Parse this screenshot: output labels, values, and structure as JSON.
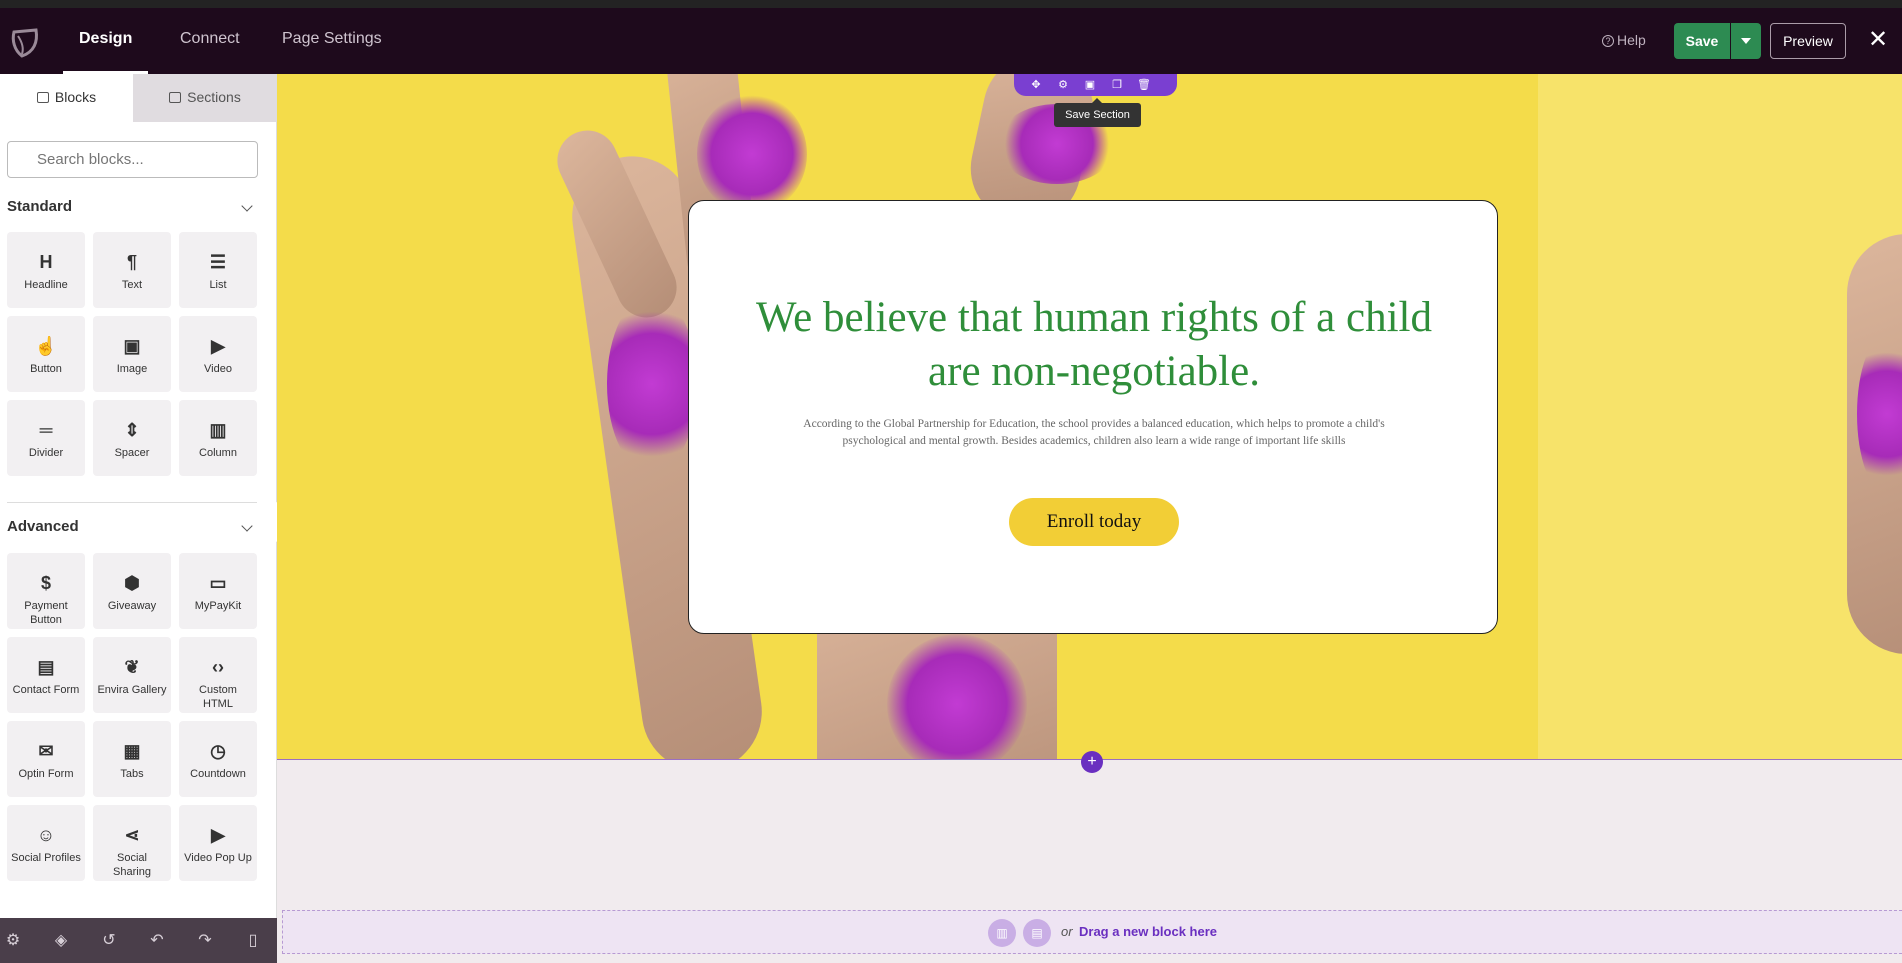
{
  "topbar": {
    "tabs": [
      {
        "label": "Design",
        "active": true
      },
      {
        "label": "Connect",
        "active": false
      },
      {
        "label": "Page Settings",
        "active": false
      }
    ],
    "help_label": "Help",
    "save_label": "Save",
    "preview_label": "Preview",
    "close_glyph": "✕"
  },
  "sidebar": {
    "tabs": [
      {
        "label": "Blocks",
        "icon": "blocks-icon"
      },
      {
        "label": "Sections",
        "icon": "sections-icon"
      }
    ],
    "search_placeholder": "Search blocks...",
    "standard": {
      "title": "Standard",
      "blocks": [
        {
          "label": "Headline",
          "icon": "headline-icon",
          "glyph": "H"
        },
        {
          "label": "Text",
          "icon": "paragraph-icon",
          "glyph": "¶"
        },
        {
          "label": "List",
          "icon": "list-icon",
          "glyph": "☰"
        },
        {
          "label": "Button",
          "icon": "pointer-icon",
          "glyph": "☝"
        },
        {
          "label": "Image",
          "icon": "image-icon",
          "glyph": "▣"
        },
        {
          "label": "Video",
          "icon": "video-icon",
          "glyph": "▶"
        },
        {
          "label": "Divider",
          "icon": "divider-icon",
          "glyph": "═"
        },
        {
          "label": "Spacer",
          "icon": "spacer-icon",
          "glyph": "⇕"
        },
        {
          "label": "Column",
          "icon": "column-icon",
          "glyph": "▥"
        }
      ]
    },
    "advanced": {
      "title": "Advanced",
      "blocks": [
        {
          "label": "Payment Button",
          "icon": "payment-icon",
          "glyph": "$"
        },
        {
          "label": "Giveaway",
          "icon": "giveaway-icon",
          "glyph": "⬢"
        },
        {
          "label": "MyPayKit",
          "icon": "card-icon",
          "glyph": "▭"
        },
        {
          "label": "Contact Form",
          "icon": "form-icon",
          "glyph": "▤"
        },
        {
          "label": "Envira Gallery",
          "icon": "leaf-icon",
          "glyph": "❦"
        },
        {
          "label": "Custom HTML",
          "icon": "code-icon",
          "glyph": "‹›"
        },
        {
          "label": "Optin Form",
          "icon": "mail-icon",
          "glyph": "✉"
        },
        {
          "label": "Tabs",
          "icon": "tabs-icon",
          "glyph": "▦"
        },
        {
          "label": "Countdown",
          "icon": "timer-icon",
          "glyph": "◷"
        },
        {
          "label": "Social Profiles",
          "icon": "users-icon",
          "glyph": "☺"
        },
        {
          "label": "Social Sharing",
          "icon": "share-icon",
          "glyph": "⋖"
        },
        {
          "label": "Video Pop Up",
          "icon": "video-popup-icon",
          "glyph": "▶"
        }
      ]
    },
    "bottom_tools": [
      {
        "icon": "settings-icon",
        "glyph": "⚙"
      },
      {
        "icon": "layers-icon",
        "glyph": "◈"
      },
      {
        "icon": "history-icon",
        "glyph": "↺"
      },
      {
        "icon": "undo-icon",
        "glyph": "↶"
      },
      {
        "icon": "redo-icon",
        "glyph": "↷"
      },
      {
        "icon": "device-icon",
        "glyph": "▯"
      }
    ]
  },
  "canvas": {
    "section_toolbar": [
      {
        "icon": "move-icon",
        "glyph": "✥"
      },
      {
        "icon": "section-settings-icon",
        "glyph": "⚙"
      },
      {
        "icon": "save-section-icon",
        "glyph": "▣"
      },
      {
        "icon": "duplicate-icon",
        "glyph": "❐"
      },
      {
        "icon": "delete-icon",
        "glyph": "🗑"
      }
    ],
    "tooltip": "Save Section",
    "headline": "We believe that human rights of a child are non-negotiable.",
    "subtext": "According to the Global Partnership for Education, the school provides a balanced education, which helps to promote a child's psychological and mental growth. Besides academics, children also learn a wide range of important life skills",
    "button_label": "Enroll today",
    "add_glyph": "+",
    "dropzone": {
      "or_text": "or",
      "cta": "Drag a new block here"
    }
  },
  "colors": {
    "topbar_bg": "#1e0a1c",
    "save_green": "#2d8b52",
    "hero_yellow": "#f4dc4a",
    "headline_green": "#2f8e3a",
    "enroll_yellow": "#f2ce36",
    "accent_purple": "#6a2fc0"
  }
}
